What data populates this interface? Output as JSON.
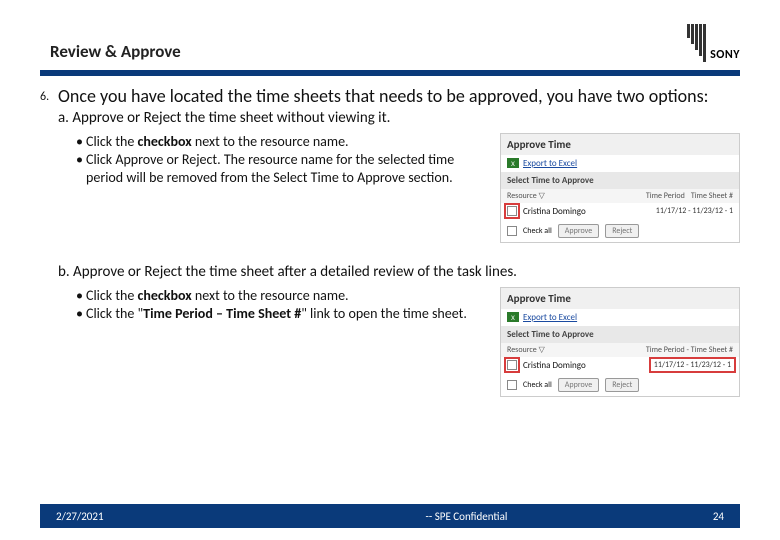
{
  "header": {
    "title": "Review & Approve",
    "logo_text": "SONY"
  },
  "step": {
    "num": "6.",
    "lead": "Once you have located the time sheets that needs to be approved, you have two options:",
    "a_label": "a.  Approve or Reject the time sheet without viewing it.",
    "a_bullets": {
      "b1_pre": "Click the ",
      "b1_bold": "checkbox",
      "b1_post": " next to the resource name.",
      "b2": "Click Approve or Reject. The resource name for the selected time period will be removed from the Select Time to Approve section."
    },
    "b_label": "b.  Approve or Reject the time sheet after a detailed review of the task lines.",
    "b_bullets": {
      "b1_pre": "Click the ",
      "b1_bold": "checkbox",
      "b1_post": " next to the resource name.",
      "b2_pre": "Click the \"",
      "b2_bold": "Time Period – Time Sheet #",
      "b2_post": "\" link to open the time sheet."
    }
  },
  "shot": {
    "title": "Approve Time",
    "excel_icon": "X",
    "export": "Export to Excel",
    "subhdr": "Select Time to Approve",
    "col_resource": "Resource ▽",
    "col_tp": "Time Period",
    "col_ts": "Time Sheet #",
    "col_tpts": "Time Period - Time Sheet #",
    "name": "Cristina Domingo",
    "period": "11/17/12 - 11/23/12 - 1",
    "checkall": "Check all",
    "approve": "Approve",
    "reject": "Reject"
  },
  "footer": {
    "date": "2/27/2021",
    "mid": "-- SPE Confidential",
    "page": "24"
  }
}
